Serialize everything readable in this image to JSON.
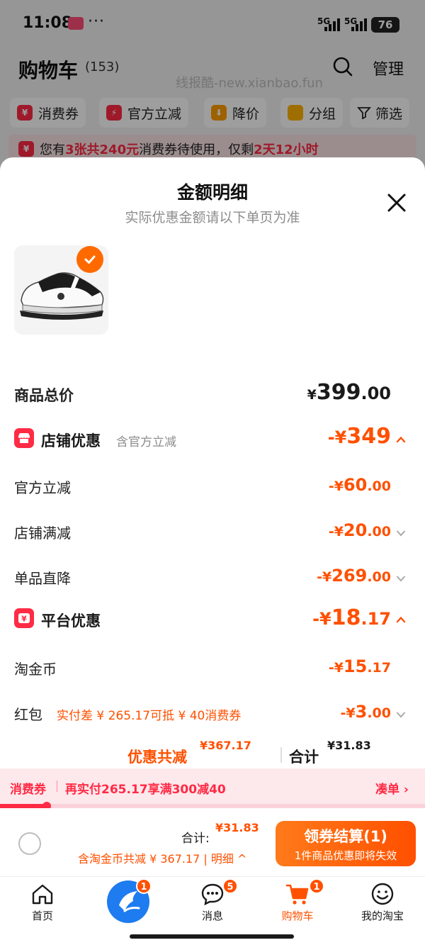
{
  "status_bar": {
    "time": "11:08",
    "dots": "···",
    "network1": "5G",
    "network2": "5G",
    "battery": "76"
  },
  "header": {
    "title": "购物车",
    "count": "(153)",
    "manage": "管理",
    "watermark": "线报酷-new.xianbao.fun"
  },
  "filter_chips": [
    {
      "label": "消费券",
      "icon": "coupon-icon"
    },
    {
      "label": "官方立减",
      "icon": "lightning-icon"
    },
    {
      "label": "降价",
      "icon": "price-drop-icon"
    },
    {
      "label": "分组",
      "icon": "folder-icon"
    },
    {
      "label": "筛选",
      "icon": "filter-icon"
    }
  ],
  "notice": {
    "prefix": "您有",
    "highlight1": "3张共240元",
    "middle": "消费券待使用，仅剩",
    "highlight2": "2天12小时"
  },
  "sheet": {
    "title": "金额明细",
    "subtitle": "实际优惠金额请以下单页为准",
    "product_image": "white-black-sneaker"
  },
  "breakdown": {
    "total": {
      "label": "商品总价",
      "currency": "¥",
      "int": "399",
      "dec": ".00"
    },
    "store": {
      "title": "店铺优惠",
      "subtitle": "含官方立减",
      "sign": "-¥",
      "int": "349",
      "dec": "",
      "items": [
        {
          "label": "官方立减",
          "sign": "-¥",
          "int": "60",
          "dec": ".00",
          "chevron": false
        },
        {
          "label": "店铺满减",
          "sign": "-¥",
          "int": "20",
          "dec": ".00",
          "chevron": true
        },
        {
          "label": "单品直降",
          "sign": "-¥",
          "int": "269",
          "dec": ".00",
          "chevron": true
        }
      ]
    },
    "platform": {
      "title": "平台优惠",
      "sign": "-¥",
      "int": "18",
      "dec": ".17",
      "items": [
        {
          "label": "淘金币",
          "sign": "-¥",
          "int": "15",
          "dec": ".17",
          "hint": ""
        },
        {
          "label": "红包",
          "sign": "-¥",
          "int": "3",
          "dec": ".00",
          "hint": "实付差 ¥ 265.17可抵 ¥ 40消费券"
        }
      ]
    },
    "summary": {
      "discount_label": "优惠共减",
      "discount_sign": "¥",
      "discount_int": "367",
      "discount_dec": ".17",
      "total_label": "合计",
      "total_sign": "¥",
      "total_int": "31",
      "total_dec": ".83"
    }
  },
  "coupon_strip": {
    "tag": "消费券",
    "message": "再实付265.17享满300减40",
    "link": "凑单 ›",
    "progress": 0.11
  },
  "checkout": {
    "total_label": "合计:",
    "total_sign": "¥",
    "total_int": "31",
    "total_dec": ".83",
    "detail": "含淘金币共减 ¥ 367.17 | 明细 ^",
    "button_line1": "领券结算(1)",
    "button_line2": "1件商品优惠即将失效"
  },
  "tabbar": [
    {
      "label": "首页",
      "icon": "home-icon",
      "badge": ""
    },
    {
      "label": "",
      "icon": "app-logo-icon",
      "badge": "1"
    },
    {
      "label": "消息",
      "icon": "message-icon",
      "badge": "5"
    },
    {
      "label": "购物车",
      "icon": "cart-icon",
      "badge": "1",
      "active": true
    },
    {
      "label": "我的淘宝",
      "icon": "profile-icon",
      "badge": ""
    }
  ],
  "colors": {
    "accent": "#ff5000",
    "red": "#ff2b45",
    "dim_overlay": "rgba(0,0,0,0.38)"
  }
}
